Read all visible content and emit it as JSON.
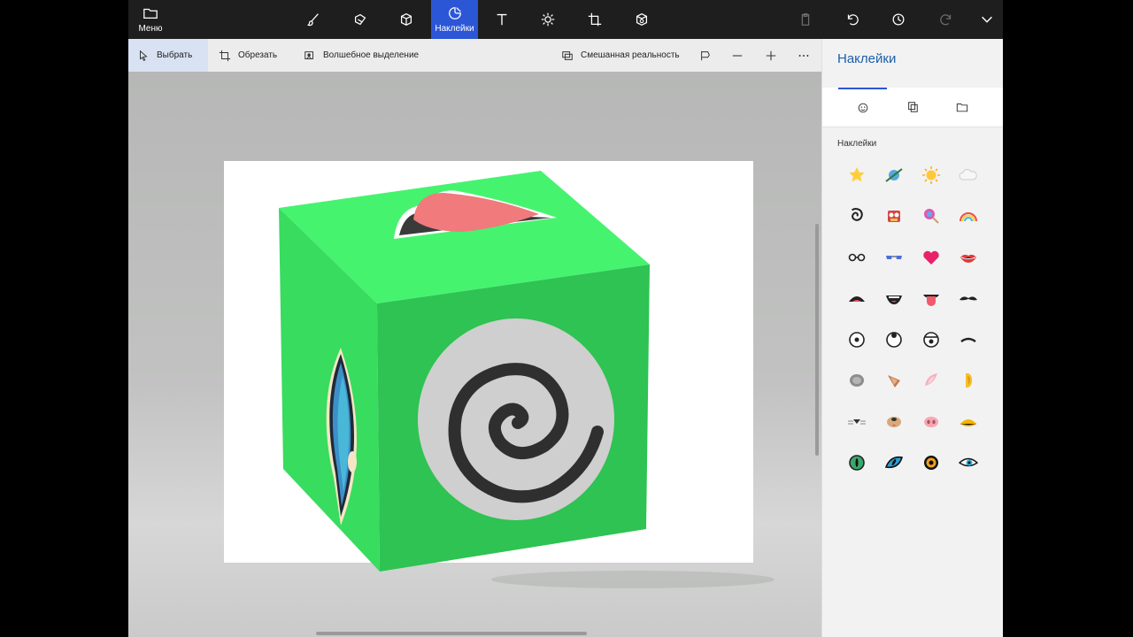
{
  "toolbar": {
    "menu_label": "Меню",
    "active_label": "Наклейки",
    "tools": [
      "brush-icon",
      "eraser-icon",
      "cube-3d-icon",
      "sticker-icon",
      "text-icon",
      "effects-icon",
      "crop-canvas-icon",
      "3d-library-icon"
    ],
    "right_tools": [
      "paste-icon",
      "undo-icon",
      "history-icon",
      "redo-icon",
      "expand-icon"
    ]
  },
  "subtoolbar": {
    "select_label": "Выбрать",
    "crop_label": "Обрезать",
    "magic_select_label": "Волшебное выделение",
    "mixed_reality_label": "Смешанная реальность"
  },
  "panel": {
    "title": "Наклейки",
    "section_label": "Наклейки",
    "tabs": [
      "sticker-tab-icon",
      "texture-tab-icon",
      "folder-tab-icon"
    ],
    "stickers": [
      [
        "star",
        "planet",
        "sun",
        "cloud"
      ],
      [
        "spiral",
        "cartoon-face",
        "lollipop",
        "rainbow"
      ],
      [
        "glasses",
        "sunglasses",
        "heart",
        "lips"
      ],
      [
        "open-mouth",
        "smile-mouth",
        "tongue",
        "mustache"
      ],
      [
        "eye-round",
        "eye-look-up",
        "eye-sad",
        "eyebrow"
      ],
      [
        "gray-ear",
        "deer-ear",
        "pink-ear",
        "yellow-ear"
      ],
      [
        "cat-nose",
        "dog-nose",
        "pig-nose",
        "duck-beak"
      ],
      [
        "green-eye",
        "blue-cat-eye",
        "amber-eye",
        "cyan-eye"
      ]
    ]
  },
  "colors": {
    "accent": "#2b56d6",
    "cube_front": "#2ec352",
    "cube_top": "#46f36f",
    "cube_side": "#38dc5f"
  }
}
